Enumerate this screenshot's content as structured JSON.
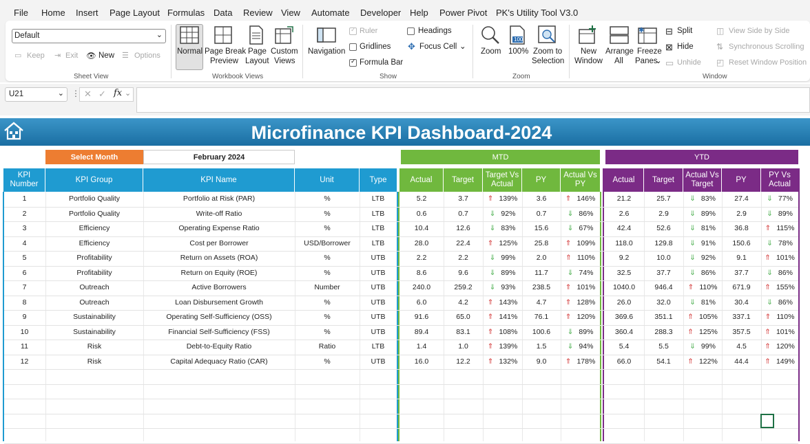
{
  "menu": [
    "File",
    "Home",
    "Insert",
    "Page Layout",
    "Formulas",
    "Data",
    "Review",
    "View",
    "Automate",
    "Developer",
    "Help",
    "Power Pivot",
    "PK's Utility Tool V3.0"
  ],
  "ribbon": {
    "sheet_view": {
      "combo_value": "Default",
      "keep": "Keep",
      "exit": "Exit",
      "new": "New",
      "options": "Options",
      "label": "Sheet View"
    },
    "workbook_views": {
      "normal": "Normal",
      "page_break_1": "Page Break",
      "page_break_2": "Preview",
      "page_layout_1": "Page",
      "page_layout_2": "Layout",
      "custom_1": "Custom",
      "custom_2": "Views",
      "label": "Workbook Views"
    },
    "show": {
      "navigation": "Navigation",
      "ruler": "Ruler",
      "gridlines": "Gridlines",
      "formula_bar": "Formula Bar",
      "headings": "Headings",
      "focus_cell": "Focus Cell",
      "label": "Show"
    },
    "zoom": {
      "zoom": "Zoom",
      "hundred_icon_text": "100",
      "hundred": "100%",
      "zoom_sel_1": "Zoom to",
      "zoom_sel_2": "Selection",
      "label": "Zoom"
    },
    "window": {
      "new_1": "New",
      "new_2": "Window",
      "arrange_1": "Arrange",
      "arrange_2": "All",
      "freeze_1": "Freeze",
      "freeze_2": "Panes",
      "split": "Split",
      "hide": "Hide",
      "unhide": "Unhide",
      "side": "View Side by Side",
      "sync": "Synchronous Scrolling",
      "reset": "Reset Window Position",
      "label": "Window"
    }
  },
  "formula_bar": {
    "name_box": "U21",
    "fx": "fx",
    "formula": ""
  },
  "dashboard": {
    "title": "Microfinance KPI Dashboard-2024",
    "select_month_label": "Select Month",
    "selected_month": "February 2024",
    "mtd_label": "MTD",
    "ytd_label": "YTD",
    "headers": {
      "kpi_number": [
        "KPI",
        "Number"
      ],
      "kpi_group": "KPI Group",
      "kpi_name": "KPI Name",
      "unit": "Unit",
      "type": "Type",
      "mtd": {
        "actual": "Actual",
        "target": "Target",
        "tvsa": [
          "Target Vs",
          "Actual"
        ],
        "py": "PY",
        "avspy": [
          "Actual Vs",
          "PY"
        ]
      },
      "ytd": {
        "actual": "Actual",
        "target": "Target",
        "avst": [
          "Actual Vs",
          "Target"
        ],
        "py": "PY",
        "pyvsa": [
          "PY Vs",
          "Actual"
        ]
      }
    },
    "colors": {
      "banner": "#1a6ea2",
      "select_month": "#ed7d31",
      "kpi_header": "#1f9bd1",
      "mtd": "#70b83e",
      "ytd": "#7b2b86",
      "arrow_up": "#d43b3b",
      "arrow_down": "#4caf50"
    },
    "rows": [
      {
        "no": "1",
        "group": "Portfolio Quality",
        "name": "Portfolio at Risk (PAR)",
        "unit": "%",
        "type": "LTB",
        "m_act": "5.2",
        "m_tgt": "3.7",
        "m_tva_arrow": "up",
        "m_tva": "139%",
        "m_py": "3.6",
        "m_avp_arrow": "up",
        "m_avp": "146%",
        "y_act": "21.2",
        "y_tgt": "25.7",
        "y_avt_arrow": "down",
        "y_avt": "83%",
        "y_py": "27.4",
        "y_pva_arrow": "down",
        "y_pva": "77%"
      },
      {
        "no": "2",
        "group": "Portfolio Quality",
        "name": "Write-off Ratio",
        "unit": "%",
        "type": "LTB",
        "m_act": "0.6",
        "m_tgt": "0.7",
        "m_tva_arrow": "down",
        "m_tva": "92%",
        "m_py": "0.7",
        "m_avp_arrow": "down",
        "m_avp": "86%",
        "y_act": "2.6",
        "y_tgt": "2.9",
        "y_avt_arrow": "down",
        "y_avt": "89%",
        "y_py": "2.9",
        "y_pva_arrow": "down",
        "y_pva": "89%"
      },
      {
        "no": "3",
        "group": "Efficiency",
        "name": "Operating Expense Ratio",
        "unit": "%",
        "type": "LTB",
        "m_act": "10.4",
        "m_tgt": "12.6",
        "m_tva_arrow": "down",
        "m_tva": "83%",
        "m_py": "15.6",
        "m_avp_arrow": "down",
        "m_avp": "67%",
        "y_act": "42.4",
        "y_tgt": "52.6",
        "y_avt_arrow": "down",
        "y_avt": "81%",
        "y_py": "36.8",
        "y_pva_arrow": "up",
        "y_pva": "115%"
      },
      {
        "no": "4",
        "group": "Efficiency",
        "name": "Cost per Borrower",
        "unit": "USD/Borrower",
        "type": "LTB",
        "m_act": "28.0",
        "m_tgt": "22.4",
        "m_tva_arrow": "up",
        "m_tva": "125%",
        "m_py": "25.8",
        "m_avp_arrow": "up",
        "m_avp": "109%",
        "y_act": "118.0",
        "y_tgt": "129.8",
        "y_avt_arrow": "down",
        "y_avt": "91%",
        "y_py": "150.6",
        "y_pva_arrow": "down",
        "y_pva": "78%"
      },
      {
        "no": "5",
        "group": "Profitability",
        "name": "Return on Assets (ROA)",
        "unit": "%",
        "type": "UTB",
        "m_act": "2.2",
        "m_tgt": "2.2",
        "m_tva_arrow": "down",
        "m_tva": "99%",
        "m_py": "2.0",
        "m_avp_arrow": "up",
        "m_avp": "110%",
        "y_act": "9.2",
        "y_tgt": "10.0",
        "y_avt_arrow": "down",
        "y_avt": "92%",
        "y_py": "9.1",
        "y_pva_arrow": "up",
        "y_pva": "101%"
      },
      {
        "no": "6",
        "group": "Profitability",
        "name": "Return on Equity (ROE)",
        "unit": "%",
        "type": "UTB",
        "m_act": "8.6",
        "m_tgt": "9.6",
        "m_tva_arrow": "down",
        "m_tva": "89%",
        "m_py": "11.7",
        "m_avp_arrow": "down",
        "m_avp": "74%",
        "y_act": "32.5",
        "y_tgt": "37.7",
        "y_avt_arrow": "down",
        "y_avt": "86%",
        "y_py": "37.7",
        "y_pva_arrow": "down",
        "y_pva": "86%"
      },
      {
        "no": "7",
        "group": "Outreach",
        "name": "Active Borrowers",
        "unit": "Number",
        "type": "UTB",
        "m_act": "240.0",
        "m_tgt": "259.2",
        "m_tva_arrow": "down",
        "m_tva": "93%",
        "m_py": "238.5",
        "m_avp_arrow": "up",
        "m_avp": "101%",
        "y_act": "1040.0",
        "y_tgt": "946.4",
        "y_avt_arrow": "up",
        "y_avt": "110%",
        "y_py": "671.9",
        "y_pva_arrow": "up",
        "y_pva": "155%"
      },
      {
        "no": "8",
        "group": "Outreach",
        "name": "Loan Disbursement Growth",
        "unit": "%",
        "type": "UTB",
        "m_act": "6.0",
        "m_tgt": "4.2",
        "m_tva_arrow": "up",
        "m_tva": "143%",
        "m_py": "4.7",
        "m_avp_arrow": "up",
        "m_avp": "128%",
        "y_act": "26.0",
        "y_tgt": "32.0",
        "y_avt_arrow": "down",
        "y_avt": "81%",
        "y_py": "30.4",
        "y_pva_arrow": "down",
        "y_pva": "86%"
      },
      {
        "no": "9",
        "group": "Sustainability",
        "name": "Operating Self-Sufficiency (OSS)",
        "unit": "%",
        "type": "UTB",
        "m_act": "91.6",
        "m_tgt": "65.0",
        "m_tva_arrow": "up",
        "m_tva": "141%",
        "m_py": "76.1",
        "m_avp_arrow": "up",
        "m_avp": "120%",
        "y_act": "369.6",
        "y_tgt": "351.1",
        "y_avt_arrow": "up",
        "y_avt": "105%",
        "y_py": "337.1",
        "y_pva_arrow": "up",
        "y_pva": "110%"
      },
      {
        "no": "10",
        "group": "Sustainability",
        "name": "Financial Self-Sufficiency (FSS)",
        "unit": "%",
        "type": "UTB",
        "m_act": "89.4",
        "m_tgt": "83.1",
        "m_tva_arrow": "up",
        "m_tva": "108%",
        "m_py": "100.6",
        "m_avp_arrow": "down",
        "m_avp": "89%",
        "y_act": "360.4",
        "y_tgt": "288.3",
        "y_avt_arrow": "up",
        "y_avt": "125%",
        "y_py": "357.5",
        "y_pva_arrow": "up",
        "y_pva": "101%"
      },
      {
        "no": "11",
        "group": "Risk",
        "name": "Debt-to-Equity Ratio",
        "unit": "Ratio",
        "type": "LTB",
        "m_act": "1.4",
        "m_tgt": "1.0",
        "m_tva_arrow": "up",
        "m_tva": "139%",
        "m_py": "1.5",
        "m_avp_arrow": "down",
        "m_avp": "94%",
        "y_act": "5.4",
        "y_tgt": "5.5",
        "y_avt_arrow": "down",
        "y_avt": "99%",
        "y_py": "4.5",
        "y_pva_arrow": "up",
        "y_pva": "120%"
      },
      {
        "no": "12",
        "group": "Risk",
        "name": "Capital Adequacy Ratio (CAR)",
        "unit": "%",
        "type": "UTB",
        "m_act": "16.0",
        "m_tgt": "12.2",
        "m_tva_arrow": "up",
        "m_tva": "132%",
        "m_py": "9.0",
        "m_avp_arrow": "up",
        "m_avp": "178%",
        "y_act": "66.0",
        "y_tgt": "54.1",
        "y_avt_arrow": "up",
        "y_avt": "122%",
        "y_py": "44.4",
        "y_pva_arrow": "up",
        "y_pva": "149%"
      }
    ]
  }
}
